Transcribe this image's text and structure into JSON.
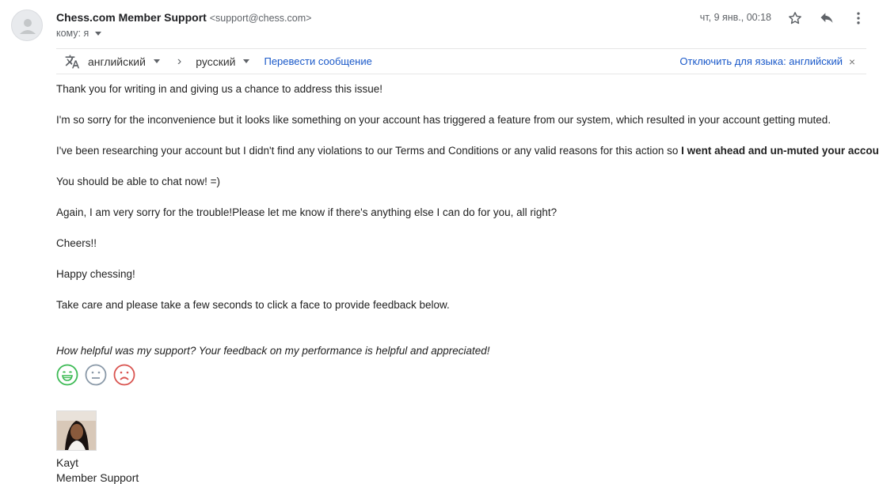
{
  "header": {
    "sender_name": "Chess.com Member Support",
    "sender_email": "<support@chess.com>",
    "recipient": "кому: я",
    "date": "чт, 9 янв., 00:18"
  },
  "translate": {
    "source_lang": "английский",
    "arrow": "›",
    "target_lang": "русский",
    "translate_link": "Перевести сообщение",
    "disable_link": "Отключить для языка: английский",
    "close": "×"
  },
  "message": {
    "p1": "Thank you for writing in and giving us a chance to address this issue!",
    "p2": "I'm so sorry for the inconvenience but it looks like something on your account has triggered a feature from our system, which resulted in your account getting muted.",
    "p3_start": "I've been researching your account but I didn't find any violations to our Terms and Conditions or any valid reasons for this action so ",
    "p3_bold": "I went ahead and un-muted your account",
    "p3_end": "!",
    "p4": "You should be able to chat now! =)",
    "p5": "Again, I am very sorry for the trouble!Please let me know if there's anything else I can do for you, all right?",
    "p6": "Cheers!!",
    "p7": "Happy chessing!",
    "p8": "Take care and please take a few seconds to click a face to provide feedback below."
  },
  "feedback": {
    "question": "How helpful was my support? Your feedback on my performance is helpful and appreciated!",
    "faces": [
      "happy-face-icon",
      "neutral-face-icon",
      "sad-face-icon"
    ],
    "colors": {
      "happy": "#3cba54",
      "neutral": "#8a99a8",
      "sad": "#d9534f"
    }
  },
  "signature": {
    "name": "Kayt",
    "title": "Member Support"
  }
}
